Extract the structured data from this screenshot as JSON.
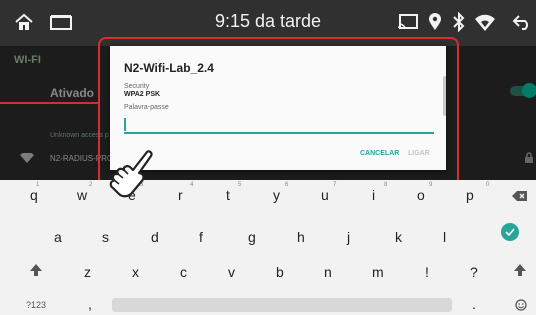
{
  "status_bar": {
    "time": "9:15 da tarde"
  },
  "wifi_screen": {
    "title": "WI-FI",
    "toggle_label": "Ativado",
    "list_header": "Unknown access p",
    "network_name": "N2-RADIUS-PRO"
  },
  "dialog": {
    "title": "N2-Wifi-Lab_2.4",
    "security_label": "Security",
    "security_value": "WPA2 PSK",
    "password_label": "Palavra-passe",
    "password_value": "",
    "cancel_label": "CANCELAR",
    "connect_label": "LIGAR"
  },
  "keyboard": {
    "row1": [
      "q",
      "w",
      "e",
      "r",
      "t",
      "y",
      "u",
      "i",
      "o",
      "p"
    ],
    "row1_hints": [
      "1",
      "2",
      "3",
      "4",
      "5",
      "6",
      "7",
      "8",
      "9",
      "0"
    ],
    "row2": [
      "a",
      "s",
      "d",
      "f",
      "g",
      "h",
      "j",
      "k",
      "l"
    ],
    "row3": [
      "z",
      "x",
      "c",
      "v",
      "b",
      "n",
      "m",
      "!",
      "?"
    ],
    "symbols_label": "?123",
    "comma_label": ",",
    "period_label": "."
  },
  "colors": {
    "accent": "#26a69a",
    "annotation": "#d32f2f",
    "status_bar": "#303030",
    "app_bg": "#2b2b2b",
    "keyboard_bg": "#f2f2f2"
  },
  "icons": [
    "home-icon",
    "recent-apps-icon",
    "cast-icon",
    "location-icon",
    "bluetooth-icon",
    "wifi-icon",
    "back-icon",
    "lock-icon",
    "wifi-signal-icon",
    "backspace-icon",
    "enter-icon",
    "shift-icon",
    "emoji-icon",
    "pointing-hand-icon"
  ]
}
